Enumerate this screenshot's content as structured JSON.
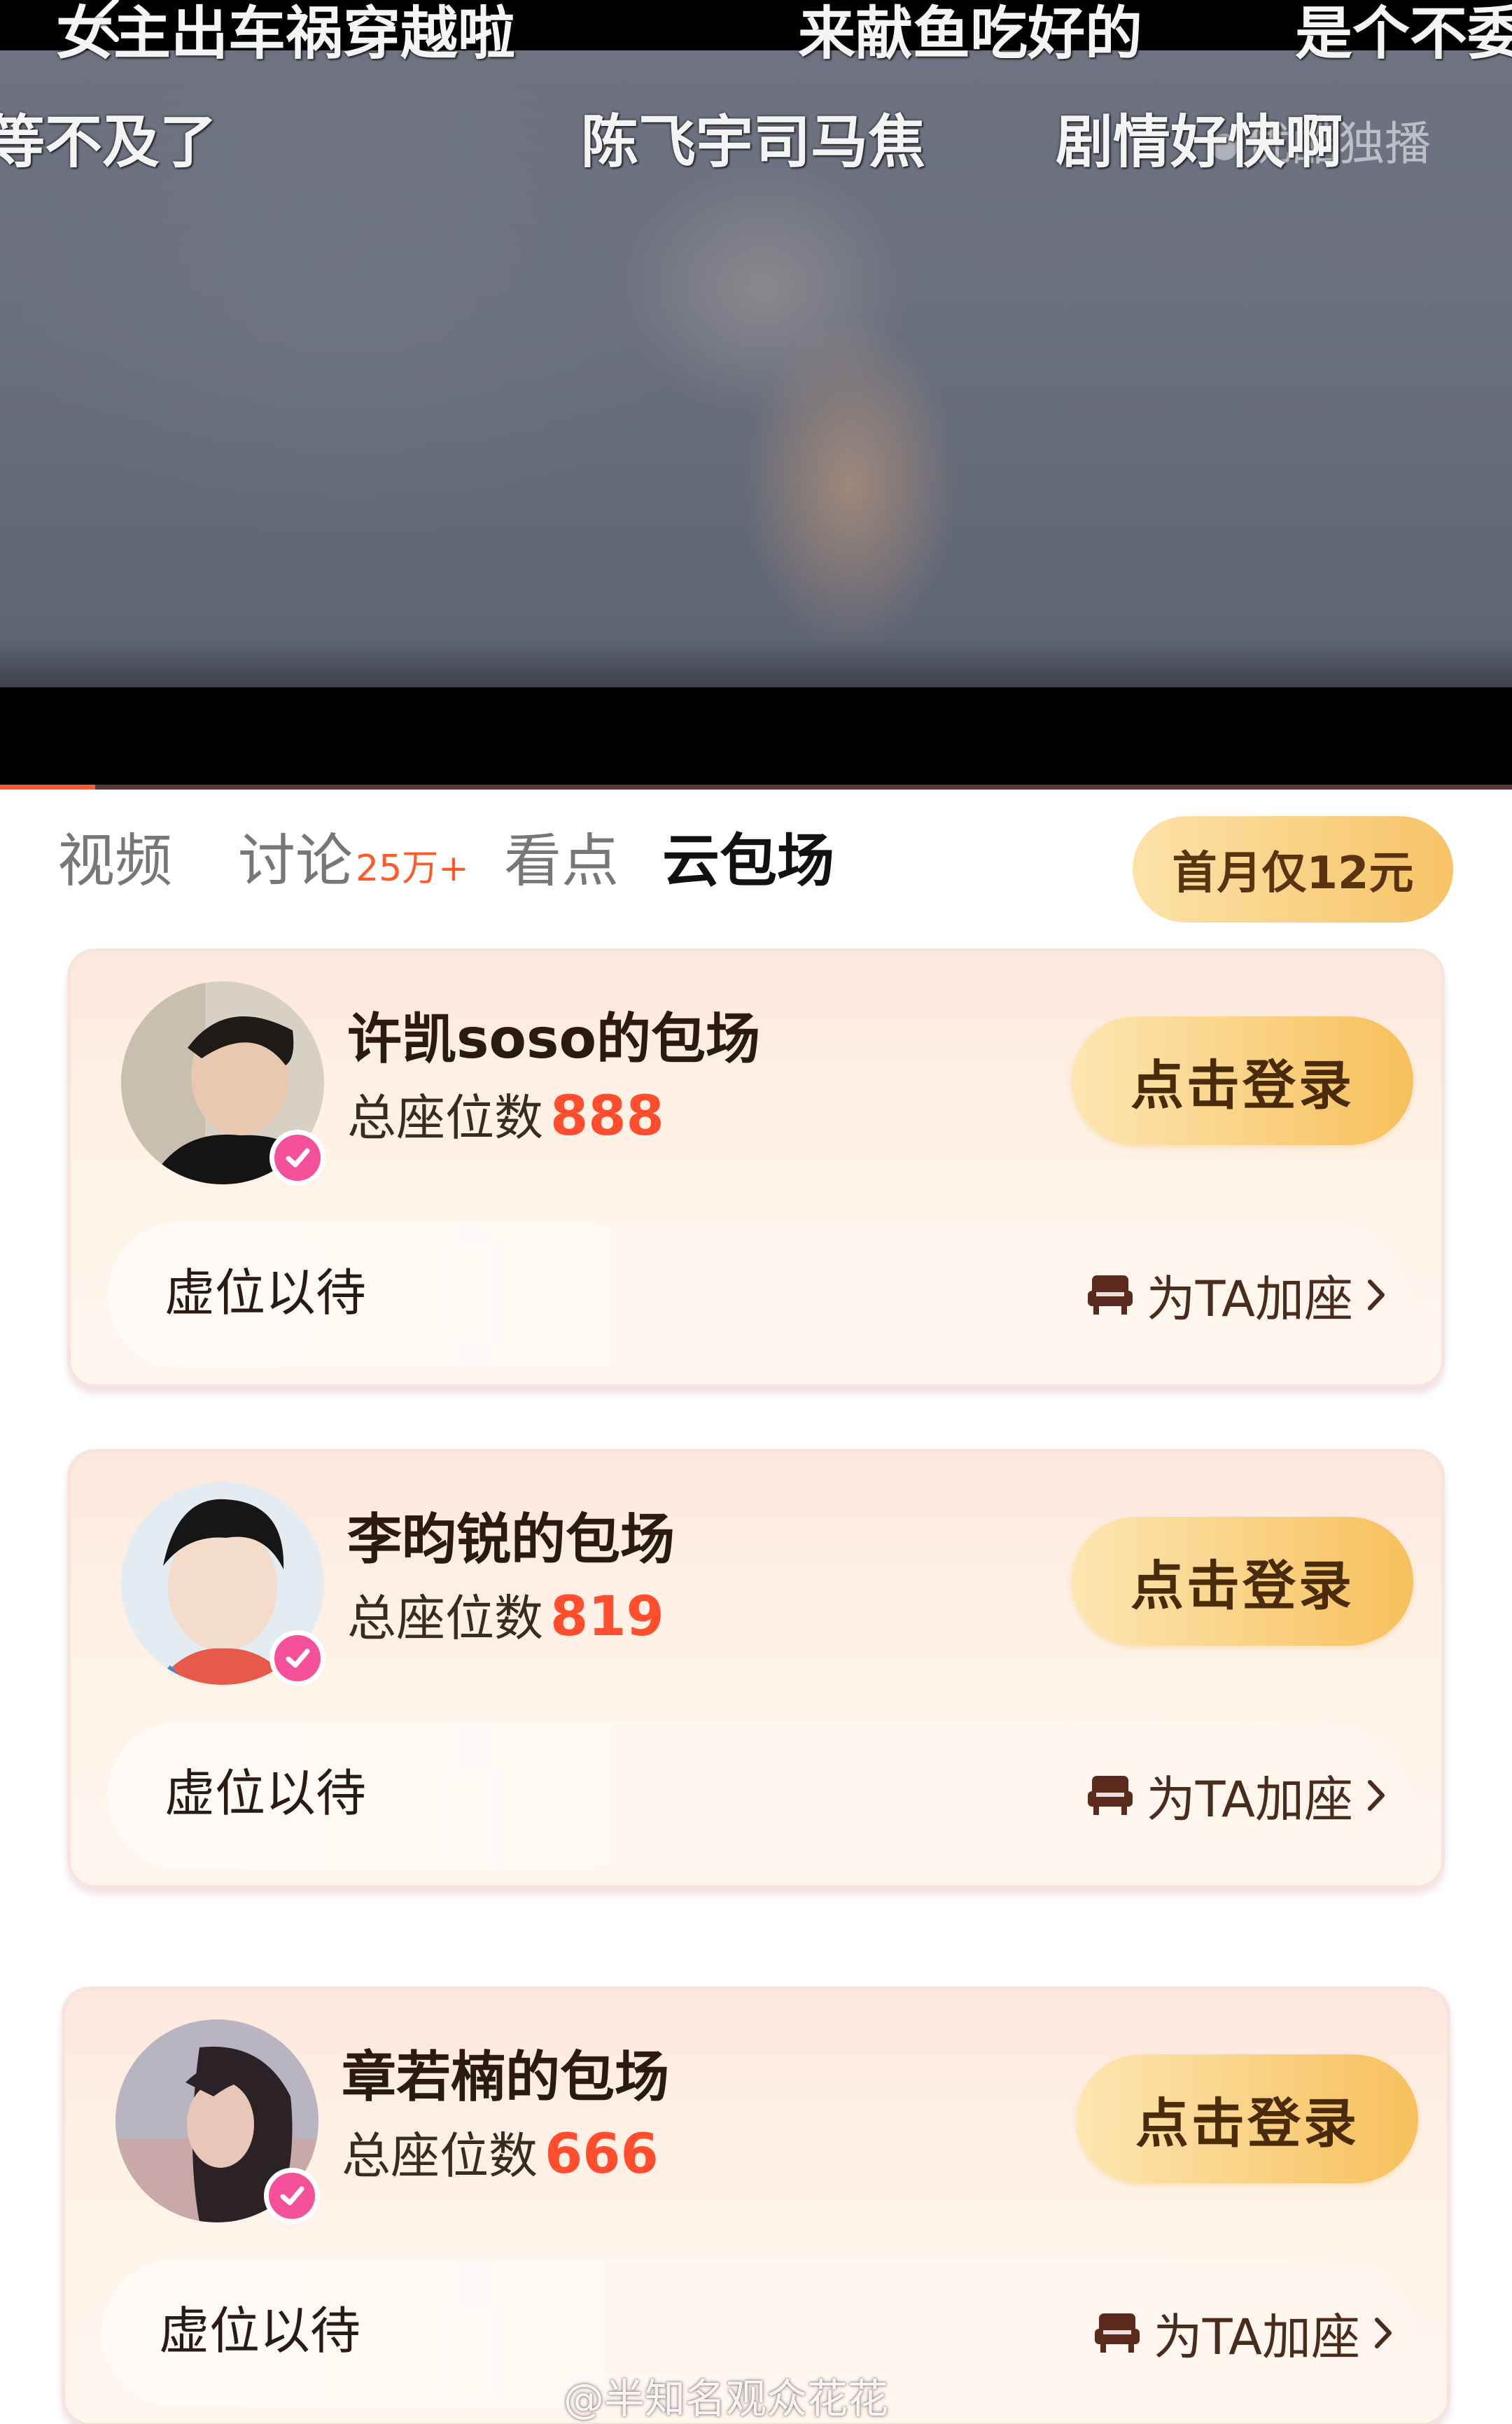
{
  "danmaku": [
    "女主出车祸穿越啦",
    "来献鱼吃好的",
    "是个不委",
    "等不及了",
    "陈飞宇司马焦",
    "剧情好快啊"
  ],
  "player": {
    "watermark": "优酷独播",
    "progress": 0.063
  },
  "tabs": [
    {
      "label": "视频",
      "badge": ""
    },
    {
      "label": "讨论",
      "badge": "25万+"
    },
    {
      "label": "看点",
      "badge": ""
    },
    {
      "label": "云包场",
      "badge": ""
    }
  ],
  "promo": {
    "label": "首月仅12元"
  },
  "cards": [
    {
      "title": "许凯soso的包场",
      "seats_label": "总座位数",
      "seats": "888",
      "login_label": "点击登录",
      "wait_label": "虚位以待",
      "add_label": "为TA加座"
    },
    {
      "title": "李昀锐的包场",
      "seats_label": "总座位数",
      "seats": "819",
      "login_label": "点击登录",
      "wait_label": "虚位以待",
      "add_label": "为TA加座"
    },
    {
      "title": "章若楠的包场",
      "seats_label": "总座位数",
      "seats": "666",
      "login_label": "点击登录",
      "wait_label": "虚位以待",
      "add_label": "为TA加座"
    }
  ],
  "footer_watermark": "@半知名观众花花",
  "colors": {
    "accent": "#ff5a2c",
    "seat_number": "#ff4d2d",
    "button_gold": "#f7c05c",
    "verified_pink": "#f5519a"
  }
}
